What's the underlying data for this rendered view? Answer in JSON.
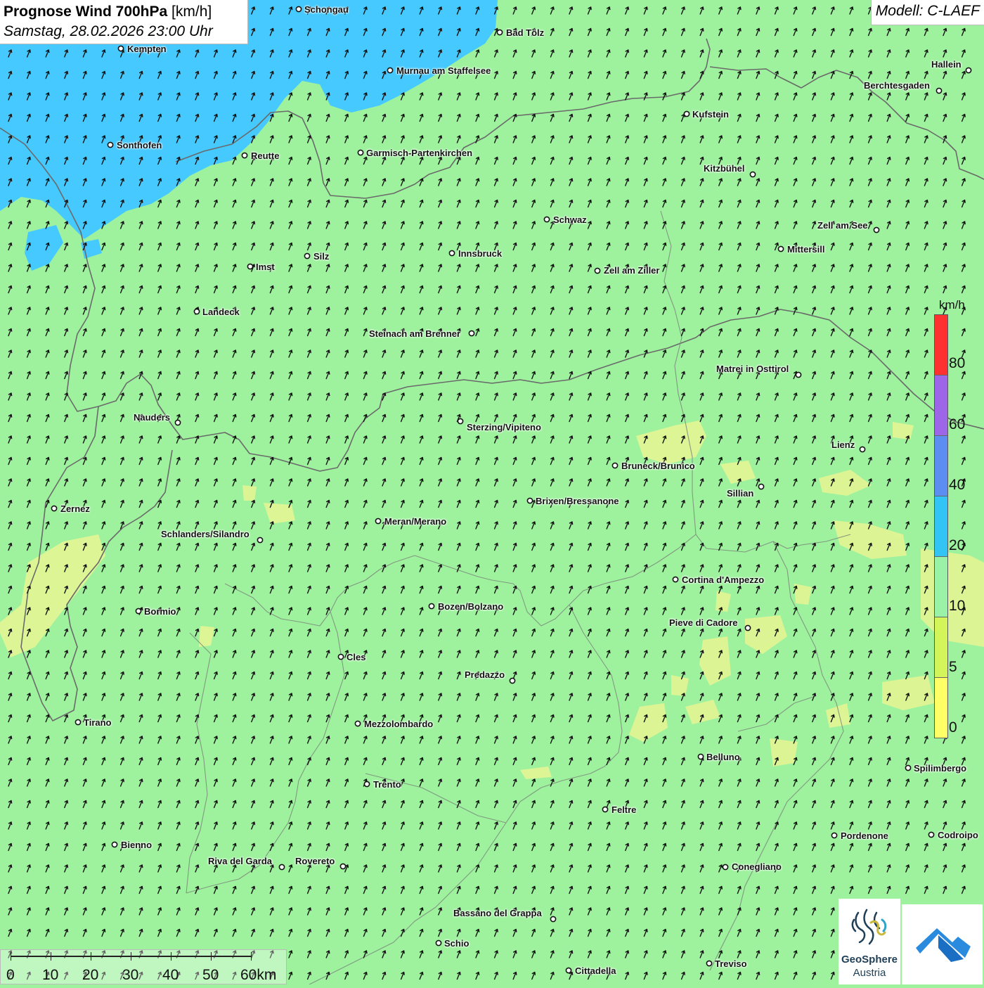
{
  "title": {
    "main": "Prognose Wind 700hPa",
    "unit": "[km/h]",
    "datetime": "Samstag, 28.02.2026 23:00 Uhr"
  },
  "model": "Modell: C-LAEF",
  "legend": {
    "unit": "km/h",
    "ticks": [
      "80",
      "60",
      "40",
      "20",
      "10",
      "5",
      "0"
    ],
    "colors": [
      "#ff3030",
      "#9d66e8",
      "#5b8ef0",
      "#31c4f5",
      "#99f2a6",
      "#d4f55a",
      "#ffff66"
    ]
  },
  "scalebar": {
    "labels": [
      "0",
      "10",
      "20",
      "30",
      "40",
      "50",
      "60km"
    ]
  },
  "logos": {
    "geosphere_name": "GeoSphere",
    "geosphere_sub": "Austria"
  },
  "colors": {
    "background_field": "#9ef29e",
    "high_wind_field": "#45c9ff",
    "low_wind_field": "#e3f593"
  },
  "cities": [
    {
      "name": "Schongau"
    },
    {
      "name": "Bad Tölz"
    },
    {
      "name": "Kempten"
    },
    {
      "name": "Murnau am Staffelsee"
    },
    {
      "name": "Hallein"
    },
    {
      "name": "Berchtesgaden"
    },
    {
      "name": "Kufstein"
    },
    {
      "name": "Sonthofen"
    },
    {
      "name": "Reutte"
    },
    {
      "name": "Garmisch-Partenkirchen"
    },
    {
      "name": "Kitzbühel"
    },
    {
      "name": "Schwaz"
    },
    {
      "name": "Zell am See"
    },
    {
      "name": "Mittersill"
    },
    {
      "name": "Innsbruck"
    },
    {
      "name": "Silz"
    },
    {
      "name": "Imst"
    },
    {
      "name": "Zell am Ziller"
    },
    {
      "name": "Landeck"
    },
    {
      "name": "Steinach am Brenner"
    },
    {
      "name": "Matrei in Osttirol"
    },
    {
      "name": "Nauders"
    },
    {
      "name": "Sterzing/Vipiteno"
    },
    {
      "name": "Lienz"
    },
    {
      "name": "Bruneck/Brunico"
    },
    {
      "name": "Sillian"
    },
    {
      "name": "Zernez"
    },
    {
      "name": "Brixen/Bressanone"
    },
    {
      "name": "Meran/Merano"
    },
    {
      "name": "Schlanders/Silandro"
    },
    {
      "name": "Cortina d'Ampezzo"
    },
    {
      "name": "Bozen/Bolzano"
    },
    {
      "name": "Bormio"
    },
    {
      "name": "Pieve di Cadore"
    },
    {
      "name": "Cles"
    },
    {
      "name": "Predazzo"
    },
    {
      "name": "Tirano"
    },
    {
      "name": "Mezzolombardo"
    },
    {
      "name": "Belluno"
    },
    {
      "name": "Spilimbergo"
    },
    {
      "name": "Trento"
    },
    {
      "name": "Feltre"
    },
    {
      "name": "Pordenone"
    },
    {
      "name": "Codroipo"
    },
    {
      "name": "Bienno"
    },
    {
      "name": "Riva del Garda"
    },
    {
      "name": "Rovereto"
    },
    {
      "name": "Conegliano"
    },
    {
      "name": "Bassano del Grappa"
    },
    {
      "name": "Schio"
    },
    {
      "name": "Treviso"
    },
    {
      "name": "Cittadella"
    }
  ]
}
